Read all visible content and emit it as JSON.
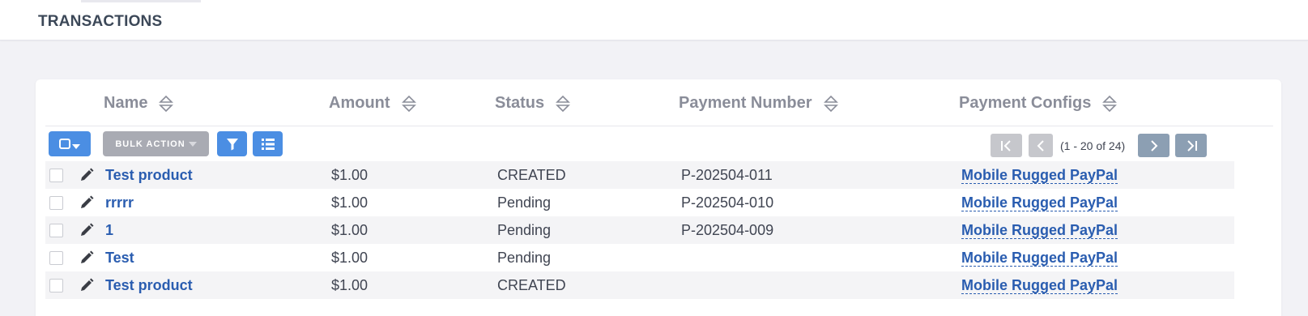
{
  "page": {
    "title": "TRANSACTIONS"
  },
  "table": {
    "columns": [
      {
        "label": "Name"
      },
      {
        "label": "Amount"
      },
      {
        "label": "Status"
      },
      {
        "label": "Payment Number"
      },
      {
        "label": "Payment Configs"
      }
    ],
    "rows": [
      {
        "name": "Test product",
        "amount": "$1.00",
        "status": "CREATED",
        "payment_number": "P-202504-011",
        "payment_config": "Mobile Rugged PayPal"
      },
      {
        "name": "rrrrr",
        "amount": "$1.00",
        "status": "Pending",
        "payment_number": "P-202504-010",
        "payment_config": "Mobile Rugged PayPal"
      },
      {
        "name": "1",
        "amount": "$1.00",
        "status": "Pending",
        "payment_number": "P-202504-009",
        "payment_config": "Mobile Rugged PayPal"
      },
      {
        "name": "Test",
        "amount": "$1.00",
        "status": "Pending",
        "payment_number": "",
        "payment_config": "Mobile Rugged PayPal"
      },
      {
        "name": "Test product",
        "amount": "$1.00",
        "status": "CREATED",
        "payment_number": "",
        "payment_config": "Mobile Rugged PayPal"
      }
    ]
  },
  "toolbar": {
    "bulk_action_label": "BULK ACTION",
    "select_icon": "select-all-icon",
    "filter_icon": "filter-icon",
    "columns_icon": "list-icon"
  },
  "pagination": {
    "range_text": "(1 - 20 of 24)"
  },
  "colors": {
    "accent": "#4b8ee3",
    "link": "#2a5db0",
    "disabled_button": "#a9abb3",
    "pager_enabled": "#8c9fb3",
    "pager_disabled": "#c6c7cc"
  }
}
